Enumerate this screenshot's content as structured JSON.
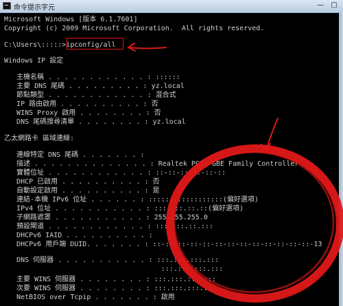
{
  "window": {
    "title": "命令提示字元",
    "min_label": "—",
    "max_label": "□"
  },
  "console": {
    "lines": [
      "Microsoft Windows [版本 6.1.7601]",
      "Copyright (c) 2009 Microsoft Corporation.  All rights reserved.",
      "",
      "C:\\Users\\:::::>ipconfig/all",
      "",
      "Windows IP 設定",
      "",
      "   主機名稱 . . . . . . . . . . . . : ::::::",
      "   主要 DNS 尾碼 . . . . . . . . . : yz.local",
      "   節點類型 . . . . . . . . . . . . : 混合式",
      "   IP 路由啟用 . . . . . . . . . . : 否",
      "   WINS Proxy 啟用 . . . . . . . . : 否",
      "   DNS 尾碼搜尋清單 . . . . . . . . : yz.local",
      "",
      "乙太網路卡 區域連線:",
      "",
      "   連線特定 DNS 尾碼 . . . . . . . :",
      "   描述 . . . . . . . . . . . . . . : Realtek PCIe GBE Family Controller",
      "   實體位址 . . . . . . . . . . . . : ::-::-::-::-::-::",
      "   DHCP 已啟用 . . . . . . . . . . : 否",
      "   自動設定啟用 . . . . . . . . . . : 是",
      "   連結-本機 IPv6 位址 . . . . . . : ::::::::::::::::::(偏好選項)",
      "   IPv4 位址 . . . . . . . . . . . : :::.:::.::.::(偏好選項)",
      "   子網路遮罩 . . . . . . . . . . . : 255.255.255.0",
      "   預設閘道 . . . . . . . . . . . . : :::.:::.::.:::",
      "   DHCPv6 IAID . . . . . . . . . . :",
      "   DHCPv6 用戶端 DUID. . . . . . . : ::-::-::-::-::-::-::-::-::-::-::-::-::-13",
      "",
      "   DNS 伺服器 . . . . . . . . . . . : :::.:::.:::.:::",
      "                                      :::.:::.:::.:::",
      "   主要 WINS 伺服器 . . . . . . . . : :::.:::.:::.:::",
      "   次要 WINS 伺服器 . . . . . . . . : :::.:::.:::.:::",
      "   NetBIOS over Tcpip . . . . . . . : 啟用"
    ]
  },
  "colors": {
    "text": "#d0d0d0",
    "background": "#000000",
    "annotation": "#e01818"
  }
}
